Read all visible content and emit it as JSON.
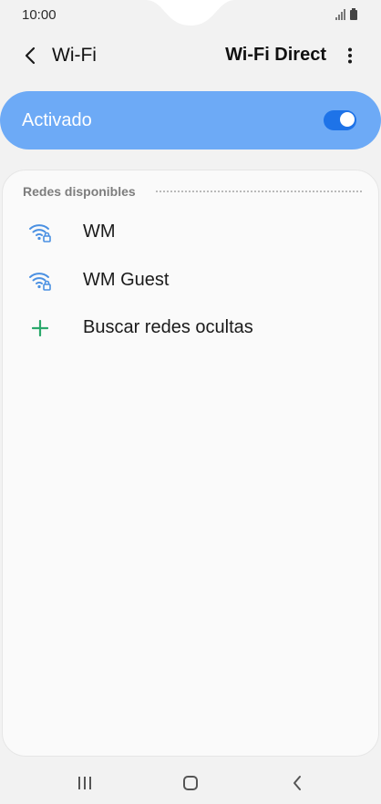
{
  "status_bar": {
    "time": "10:00",
    "icons": [
      "signal-icon",
      "battery-icon"
    ]
  },
  "app_bar": {
    "title": "Wi-Fi",
    "action_label": "Wi-Fi Direct",
    "back_icon": "chevron-left-icon",
    "menu_icon": "more-vertical-icon"
  },
  "master_toggle": {
    "label": "Activado",
    "state": "on"
  },
  "networks": {
    "section_title": "Redes disponibles",
    "items": [
      {
        "label": "WM",
        "icon": "wifi-lock-icon"
      },
      {
        "label": "WM Guest",
        "icon": "wifi-lock-icon"
      }
    ],
    "add_hidden": {
      "label": "Buscar redes ocultas",
      "icon": "plus-icon"
    }
  },
  "nav_bar": {
    "icons": [
      "recent-apps-icon",
      "home-icon",
      "back-icon"
    ]
  },
  "colors": {
    "accent": "#1e73e8",
    "toggle_card": "#6daaf6",
    "wifi_icon": "#4a90e2",
    "add_icon": "#2aa86b"
  }
}
